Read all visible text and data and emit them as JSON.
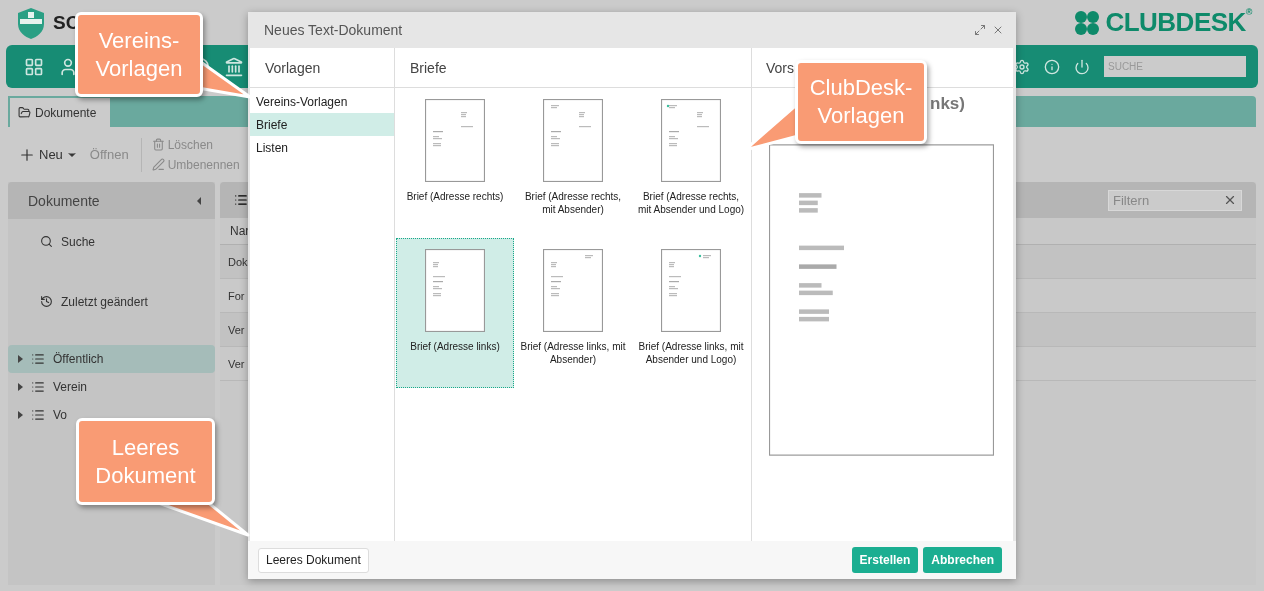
{
  "app": {
    "title": "SC",
    "logo": "CLUBDESK$^{®}$",
    "search_placeholder": "SUCHE"
  },
  "tabs": [
    {
      "label": "Dokumente",
      "selected": true
    }
  ],
  "actions": [
    {
      "label": "Neu",
      "kind": "new",
      "disabled": false
    },
    {
      "label": "Öffnen",
      "kind": "open",
      "disabled": true
    },
    {
      "label": "Löschen",
      "kind": "delete",
      "disabled": true
    },
    {
      "label": "Umbenennen",
      "kind": "rename",
      "disabled": true
    }
  ],
  "sidebar": {
    "title": "Dokumente",
    "links": [
      {
        "label": "Suche",
        "kind": "search"
      },
      {
        "label": "Zuletzt geändert",
        "kind": "recent"
      }
    ],
    "folders": [
      {
        "label": "Öffentlich",
        "selected": true,
        "expanded": false
      },
      {
        "label": "Verein",
        "selected": false,
        "expanded": false
      },
      {
        "label": "Vo",
        "selected": false,
        "expanded": false
      }
    ]
  },
  "list": {
    "filter_placeholder": "Filtern",
    "column_1": "Nar",
    "rows": [
      "Dok",
      "For",
      "Ver",
      "Ver"
    ]
  },
  "dialog": {
    "title": "Neues Text-Dokument",
    "categories_header": "Vorlagen",
    "categories": [
      {
        "label": "Vereins-Vorlagen",
        "selected": false
      },
      {
        "label": "Briefe",
        "selected": true
      },
      {
        "label": "Listen",
        "selected": false
      }
    ],
    "templates_header": "Briefe",
    "templates": [
      {
        "label": "Brief (Adresse rechts)",
        "address_right": true,
        "sender": false,
        "logo": false,
        "selected": false
      },
      {
        "label": "Brief (Adresse rechts, mit Absender)",
        "address_right": true,
        "sender": true,
        "logo": false,
        "selected": false
      },
      {
        "label": "Brief (Adresse rechts, mit Absender und Logo)",
        "address_right": true,
        "sender": true,
        "logo": true,
        "selected": false
      },
      {
        "label": "Brief (Adresse links)",
        "address_right": false,
        "sender": false,
        "logo": false,
        "selected": true
      },
      {
        "label": "Brief (Adresse links, mit Absender)",
        "address_right": false,
        "sender": true,
        "logo": false,
        "selected": false
      },
      {
        "label": "Brief (Adresse links, mit Absender und Logo)",
        "address_right": false,
        "sender": true,
        "logo": true,
        "selected": false
      }
    ],
    "preview_header": "Vors",
    "preview_title": "nks)",
    "blank_button": "Leeres Dokument",
    "buttons": [
      "Erstellen",
      "Abbrechen"
    ]
  },
  "callouts": [
    {
      "text": "Vereins-Vorlagen",
      "kind": "categories"
    },
    {
      "text": "ClubDesk-Vorlagen",
      "kind": "preview"
    },
    {
      "text": "Leeres Dokument",
      "kind": "blank"
    }
  ]
}
